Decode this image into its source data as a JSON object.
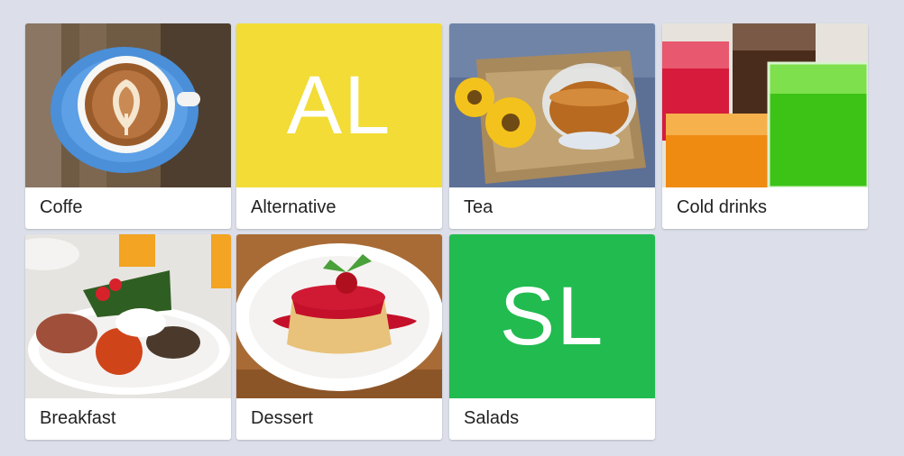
{
  "categories": [
    {
      "label": "Coffe",
      "label_overflow": "e"
    },
    {
      "label": "Alternative",
      "abbr": "AL",
      "color": "#f2dc35"
    },
    {
      "label": "Tea"
    },
    {
      "label": "Cold drinks"
    },
    {
      "label": "Breakfast"
    },
    {
      "label": "Dessert"
    },
    {
      "label": "Salads",
      "abbr": "SL",
      "color": "#22bb4f"
    }
  ]
}
